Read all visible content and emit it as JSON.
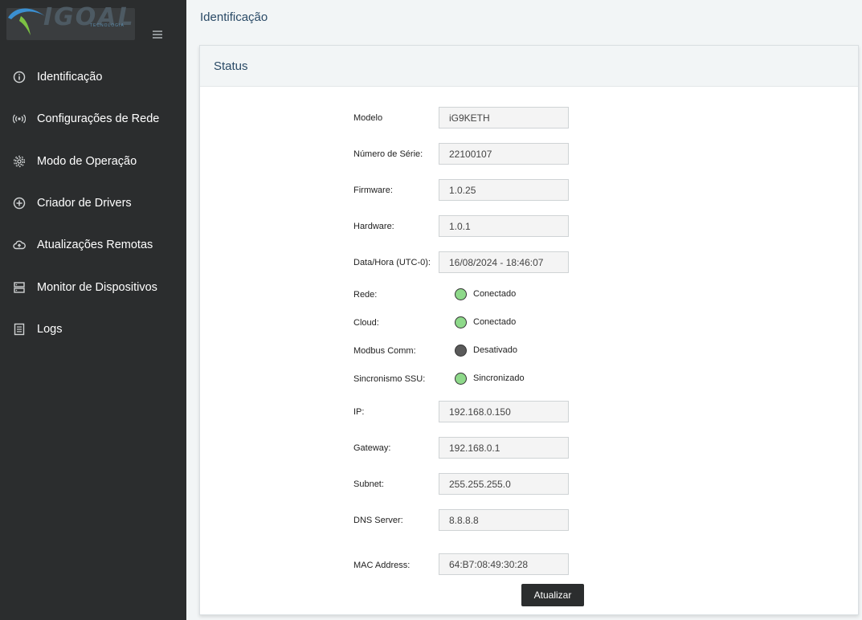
{
  "sidebar": {
    "logo_text": "IGOAL",
    "logo_subtext": "TECNOLOGIA",
    "items": [
      {
        "label": "Identificação",
        "icon": "info-icon"
      },
      {
        "label": "Configurações de Rede",
        "icon": "broadcast-icon"
      },
      {
        "label": "Modo de Operação",
        "icon": "gear-icon"
      },
      {
        "label": "Criador de Drivers",
        "icon": "plus-circle-icon"
      },
      {
        "label": "Atualizações Remotas",
        "icon": "cloud-upload-icon"
      },
      {
        "label": "Monitor de Dispositivos",
        "icon": "server-icon"
      },
      {
        "label": "Logs",
        "icon": "document-icon"
      }
    ]
  },
  "page": {
    "title": "Identificação"
  },
  "card": {
    "title": "Status",
    "fields": {
      "modelo": {
        "label": "Modelo",
        "value": "iG9KETH"
      },
      "serie": {
        "label": "Número de Série:",
        "value": "22100107"
      },
      "firmware": {
        "label": "Firmware:",
        "value": "1.0.25"
      },
      "hardware": {
        "label": "Hardware:",
        "value": "1.0.1"
      },
      "datahora": {
        "label": "Data/Hora (UTC-0):",
        "value": "16/08/2024 - 18:46:07"
      },
      "ip": {
        "label": "IP:",
        "value": "192.168.0.150"
      },
      "gateway": {
        "label": "Gateway:",
        "value": "192.168.0.1"
      },
      "subnet": {
        "label": "Subnet:",
        "value": "255.255.255.0"
      },
      "dns": {
        "label": "DNS Server:",
        "value": "8.8.8.8"
      },
      "mac": {
        "label": "MAC Address:",
        "value": "64:B7:08:49:30:28"
      }
    },
    "statuses": {
      "rede": {
        "label": "Rede:",
        "value": "Conectado",
        "color": "#8ed98a"
      },
      "cloud": {
        "label": "Cloud:",
        "value": "Conectado",
        "color": "#8ed98a"
      },
      "modbus": {
        "label": "Modbus Comm:",
        "value": "Desativado",
        "color": "#5a5a5a"
      },
      "ssu": {
        "label": "Sincronismo SSU:",
        "value": "Sincronizado",
        "color": "#8ed98a"
      }
    },
    "button_label": "Atualizar"
  }
}
